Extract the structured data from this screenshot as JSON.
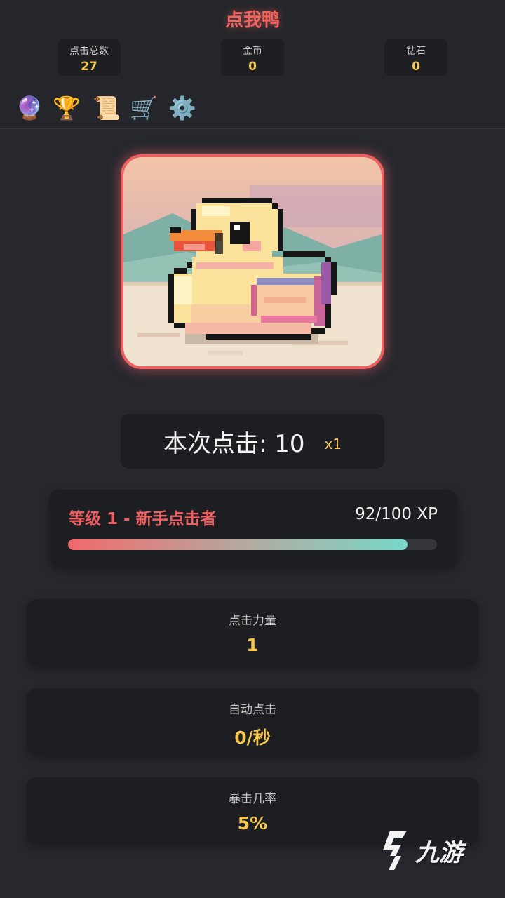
{
  "app": {
    "title": "点我鸭"
  },
  "stats_bar": [
    {
      "label": "点击总数",
      "value": "27"
    },
    {
      "label": "金币",
      "value": "0"
    },
    {
      "label": "钻石",
      "value": "0"
    }
  ],
  "menu_icons": [
    {
      "name": "crystal-ball-icon",
      "glyph": "🔮"
    },
    {
      "name": "trophy-icon",
      "glyph": "🏆"
    },
    {
      "name": "scroll-icon",
      "glyph": "📜"
    },
    {
      "name": "shopping-cart-icon",
      "glyph": "🛒"
    },
    {
      "name": "gear-icon",
      "glyph": "⚙️"
    }
  ],
  "duck": {
    "icon": "rubber-duck-pixel-art"
  },
  "click_counter": {
    "text": "本次点击: 10",
    "multiplier": "x1"
  },
  "level": {
    "title": "等级 1 - 新手点击者",
    "xp_text": "92/100 XP",
    "xp_current": 92,
    "xp_max": 100
  },
  "stat_cards": [
    {
      "label": "点击力量",
      "value": "1"
    },
    {
      "label": "自动点击",
      "value": "0/秒"
    },
    {
      "label": "暴击几率",
      "value": "5%"
    }
  ],
  "watermark": {
    "text": "九游"
  },
  "colors": {
    "accent_red": "#ee5f62",
    "gold": "#f7c64c",
    "teal": "#78d8c8",
    "background": "#26282e"
  }
}
